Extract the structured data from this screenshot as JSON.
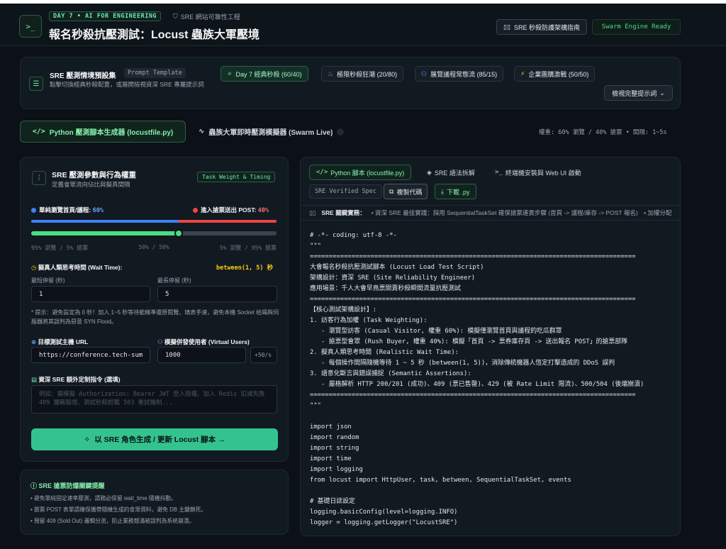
{
  "colors": {
    "accent": "#4ade80",
    "accent_bg": "#10241d",
    "red": "#ef4444",
    "blue": "#3b82f6",
    "bg": "#0b1116"
  },
  "header": {
    "logo_text": ">_",
    "day_badge": "DAY 7 • AI FOR ENGINEERING",
    "sre_label": "SRE 網站可靠性工程",
    "title": "報名秒殺抗壓測試：Locust 蟲族大軍壓境",
    "guide_button": "SRE 秒殺防護架構指南",
    "status": "Swarm Engine Ready"
  },
  "presets": {
    "title": "SRE 壓測情境預設集",
    "tag": "Prompt Template",
    "desc": "點擊切換經典秒殺配置，或展開檢視資深 SRE 專屬提示詞",
    "view_all": "檢視完整提示詞",
    "items": [
      {
        "label": "Day 7 經典秒殺 (60/40)",
        "icon": "sparkle-icon"
      },
      {
        "label": "極限秒殺狂潮 (20/80)",
        "icon": "flame-icon"
      },
      {
        "label": "展覽議程常態流 (85/15)",
        "icon": "users-icon"
      },
      {
        "label": "企業團購激戰 (50/50)",
        "icon": "bolt-icon"
      }
    ]
  },
  "tabs": {
    "generator": "Python 壓測腳本生成器 (locustfile.py)",
    "swarm": "蟲族大軍即時壓測模擬器 (Swarm Live)",
    "summary": "權重: 60% 瀏覽 / 40% 搶票 • 間隔: 1~5s"
  },
  "params": {
    "title": "SRE 壓測參數與行為權重",
    "subtitle": "定義會眾流向佔比與擬真間隔",
    "tag": "Task Weight & Timing",
    "browse_label": "單純瀏覽首頁/議程:",
    "browse_value": "60%",
    "buy_label": "進入搶票送出 POST:",
    "buy_value": "40%",
    "browse_fraction": 0.6,
    "slider_fraction": 0.6,
    "ticks": [
      "95% 瀏覽 / 5% 搶票",
      "50% / 50%",
      "5% 瀏覽 / 95% 搶票"
    ],
    "wait_label": "擬真人類思考時間 (Wait Time):",
    "wait_value": "between(1, 5) 秒",
    "min_label": "最短停留 (秒)",
    "min_value": "1",
    "max_label": "最長停留 (秒)",
    "max_value": "5",
    "note": "* 提示：避免設定為 0 秒！加入 1~5 秒等待能精準還原閱覽、填表手速，避免本機 Socket 枯竭與伺服器將其誤判為惡意 SYN Flood。",
    "host_label": "目標測試主機 URL",
    "host_value": "https://conference.tech-sum",
    "users_label": "模擬併發使用者 (Virtual Users)",
    "users_value": "1000",
    "rate": "+50/s",
    "extra_label": "資深 SRE 額外定制指令 (選填)",
    "extra_placeholder": "例如：需模擬 Authorization: Bearer JWT 登入授權、加入 Redis 扣減失敗 409 攔截驗證、測試秒殺超載 503 重試機制...",
    "generate": "以 SRE 角色生成 / 更新 Locust 腳本 →"
  },
  "tips": {
    "title": "SRE 搶票防爆關鍵提醒",
    "items": [
      "• 避免單純固定速率壓測，請務必保留 wait_time 隨機抖動。",
      "• 搶票 POST 表單請確保攜帶隨機生成的會眾資料，避免 DB 主鍵鎖死。",
      "• 預留 409 (Sold Out) 邏輯分流，防止業務競滿被誤判為系統崩潰。"
    ]
  },
  "code": {
    "tabs": [
      "Python 腳本 (locustfile.py)",
      "SRE 語法拆解",
      "終端機安裝與 Web UI 啟動"
    ],
    "spec": "SRE Verified Spec",
    "copy": "複製代碼",
    "download": "下載 .py",
    "insight_label": "SRE 關鍵實務：",
    "insight_text": "• 資深 SRE 最佳實踐：採用 SequentialTaskSet 確保搶票連貫步驟 (首頁 -> 議程/庫存 -> POST 報名)　• 加權分配",
    "lines": [
      "# -*- coding: utf-8 -*-",
      "\"\"\"",
      "======================================================================================",
      "大會報名秒殺抗壓測試腳本 (Locust Load Test Script)",
      "架構設計：資深 SRE (Site Reliability Engineer)",
      "應用場景：千人大會早鳥票開賣秒殺瞬間流量抗壓測試",
      "======================================================================================",
      "【核心測試架構設計】:",
      "1. 訪客行為加權 (Task Weighting):",
      "   - 瀏覽型訪客 (Casual Visitor, 權重 60%): 模擬僅瀏覽首頁與議程的吃瓜群眾",
      "   - 搶票型會眾 (Rush Buyer, 權重 40%): 模擬「首頁 -> 票券庫存頁 -> 送出報名 POST」的搶票部隊",
      "2. 擬真人類思考時間 (Realistic Wait Time):",
      "   - 每個操作間隔隨機等待 1 ~ 5 秒 (between(1, 5))，消除傳統機器人恆定打擊造成的 DDoS 誤判",
      "3. 語意化斷言與錯誤捕捉 (Semantic Assertions):",
      "   - 嚴格解析 HTTP 200/201 (成功)、409 (票已售罄)、429 (被 Rate Limit 限流)、500/504 (後端崩潰)",
      "======================================================================================",
      "\"\"\"",
      "",
      "import json",
      "import random",
      "import string",
      "import time",
      "import logging",
      "from locust import HttpUser, task, between, SequentialTaskSet, events",
      "",
      "# 基礎日誌設定",
      "logging.basicConfig(level=logging.INFO)",
      "logger = logging.getLogger(\"LocustSRE\")"
    ]
  }
}
